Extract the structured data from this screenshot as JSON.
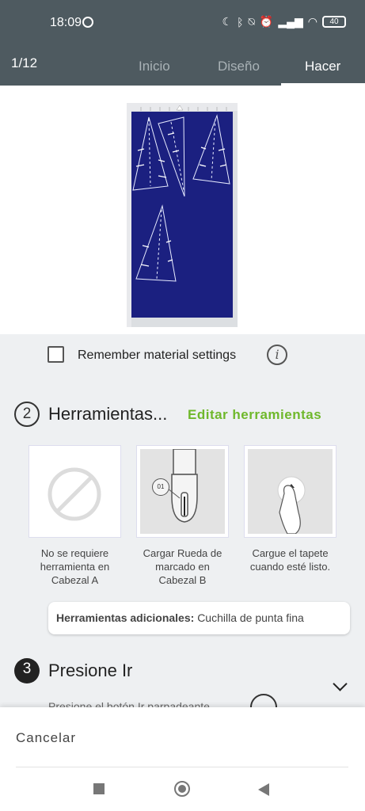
{
  "status_bar": {
    "time": "18:09",
    "icons": [
      "whatsapp-icon",
      "moon-icon",
      "bluetooth-icon",
      "vibrate-off-icon",
      "alarm-icon",
      "signal-icon",
      "wifi-icon",
      "battery-icon"
    ],
    "battery": "40"
  },
  "header": {
    "counter": "1/12",
    "tabs": [
      {
        "label": "Inicio",
        "active": false
      },
      {
        "label": "Diseño",
        "active": false
      },
      {
        "label": "Hacer",
        "active": true
      }
    ]
  },
  "material": {
    "remember_label": "Remember material settings",
    "checked": false
  },
  "step2": {
    "number": "2",
    "title": "Herramientas...",
    "edit_label": "Editar herramientas",
    "cards": [
      {
        "caption": "No se requiere herramienta en Cabezal A",
        "icon": "no-tool-icon"
      },
      {
        "caption": "Cargar Rueda de marcado en Cabezal B",
        "icon": "scoring-wheel-icon",
        "clamp": "01"
      },
      {
        "caption": "Cargue el tapete cuando esté listo.",
        "icon": "load-mat-icon"
      }
    ],
    "extra_label": "Herramientas adicionales:",
    "extra_value": "Cuchilla de punta fina"
  },
  "step3": {
    "number": "3",
    "title": "Presione Ir",
    "description": "Presione el botón Ir parpadeante"
  },
  "footer": {
    "cancel_label": "Cancelar"
  },
  "colors": {
    "header_bg": "#4e5a60",
    "accent_green": "#6fb82b",
    "mat_blue": "#1b2080"
  }
}
